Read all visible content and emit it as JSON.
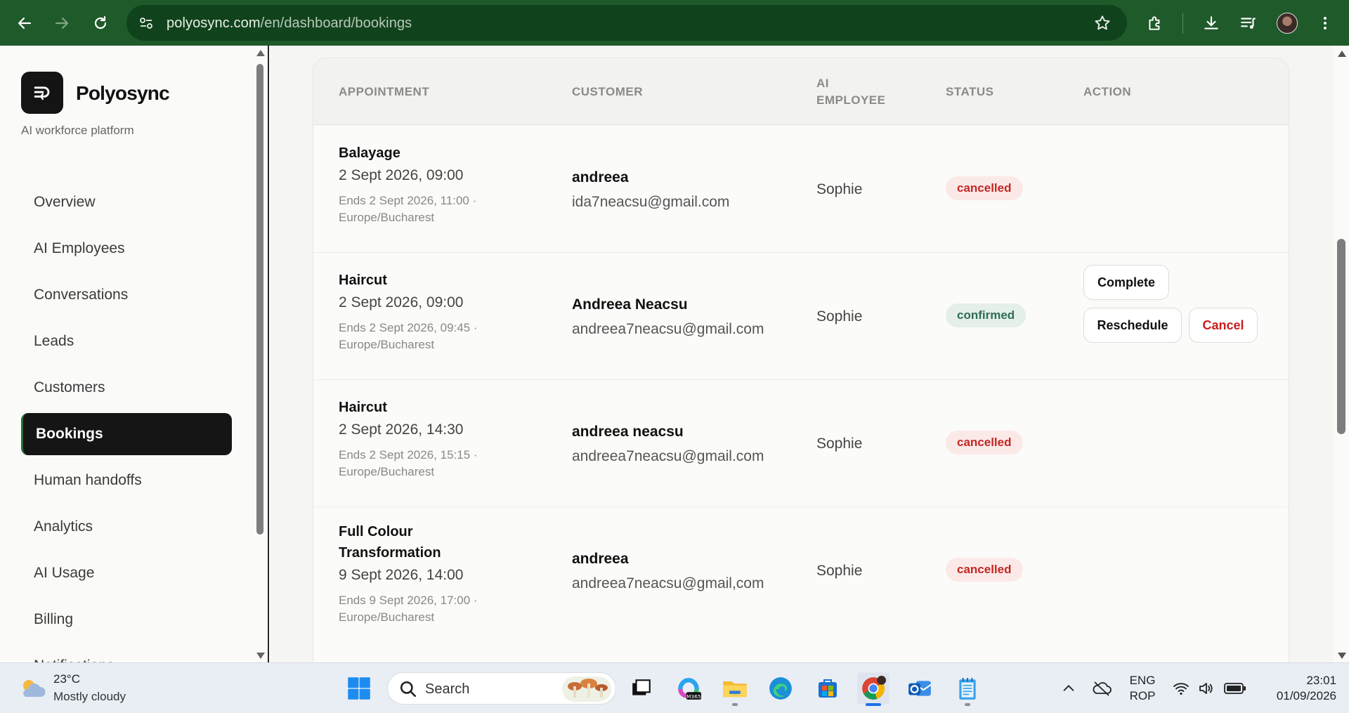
{
  "browser": {
    "url_domain": "polyosync.com",
    "url_path": "/en/dashboard/bookings",
    "back_icon": "arrow-left-icon",
    "forward_icon": "arrow-right-icon",
    "reload_icon": "reload-icon",
    "bookmark_icon": "star-icon"
  },
  "sidebar": {
    "brand_name": "Polyosync",
    "tagline": "AI workforce platform",
    "items": [
      {
        "label": "Overview",
        "active": false
      },
      {
        "label": "AI Employees",
        "active": false
      },
      {
        "label": "Conversations",
        "active": false
      },
      {
        "label": "Leads",
        "active": false
      },
      {
        "label": "Customers",
        "active": false
      },
      {
        "label": "Bookings",
        "active": true
      },
      {
        "label": "Human handoffs",
        "active": false
      },
      {
        "label": "Analytics",
        "active": false
      },
      {
        "label": "AI Usage",
        "active": false
      },
      {
        "label": "Billing",
        "active": false
      },
      {
        "label": "Notifications",
        "active": false
      }
    ]
  },
  "table": {
    "headers": {
      "appointment": "APPOINTMENT",
      "customer": "CUSTOMER",
      "employee_line1": "AI",
      "employee_line2": "EMPLOYEE",
      "status": "STATUS",
      "action": "ACTION"
    },
    "rows": [
      {
        "title": "Balayage",
        "time": "2 Sept 2026, 09:00",
        "ends_line1": "Ends 2 Sept 2026, 11:00 ·",
        "ends_line2": "Europe/Bucharest",
        "customer_name": "andreea",
        "customer_email": "ida7neacsu@gmail.com",
        "employee": "Sophie",
        "status": "cancelled"
      },
      {
        "title": "Haircut",
        "time": "2 Sept 2026, 09:00",
        "ends_line1": "Ends 2 Sept 2026, 09:45 ·",
        "ends_line2": "Europe/Bucharest",
        "customer_name": "Andreea Neacsu",
        "customer_email": "andreea7neacsu@gmail.com",
        "employee": "Sophie",
        "status": "confirmed",
        "actions": {
          "complete": "Complete",
          "reschedule": "Reschedule",
          "cancel": "Cancel"
        }
      },
      {
        "title": "Haircut",
        "time": "2 Sept 2026, 14:30",
        "ends_line1": "Ends 2 Sept 2026, 15:15 ·",
        "ends_line2": "Europe/Bucharest",
        "customer_name": "andreea neacsu",
        "customer_email": "andreea7neacsu@gmail.com",
        "employee": "Sophie",
        "status": "cancelled"
      },
      {
        "title_line1": "Full Colour",
        "title_line2": "Transformation",
        "time": "9 Sept 2026, 14:00",
        "ends_line1": "Ends 9 Sept 2026, 17:00 ·",
        "ends_line2": "Europe/Bucharest",
        "customer_name": "andreea",
        "customer_email": "andreea7neacsu@gmail,com",
        "employee": "Sophie",
        "status": "cancelled"
      }
    ]
  },
  "taskbar": {
    "weather_temp": "23°C",
    "weather_desc": "Mostly cloudy",
    "search_label": "Search",
    "lang_line1": "ENG",
    "lang_line2": "ROP",
    "time": "23:01",
    "date": "01/09/2026",
    "colors": {
      "chrome_accent": "#1a73e8",
      "browser_frame": "#1f5a2a"
    }
  }
}
